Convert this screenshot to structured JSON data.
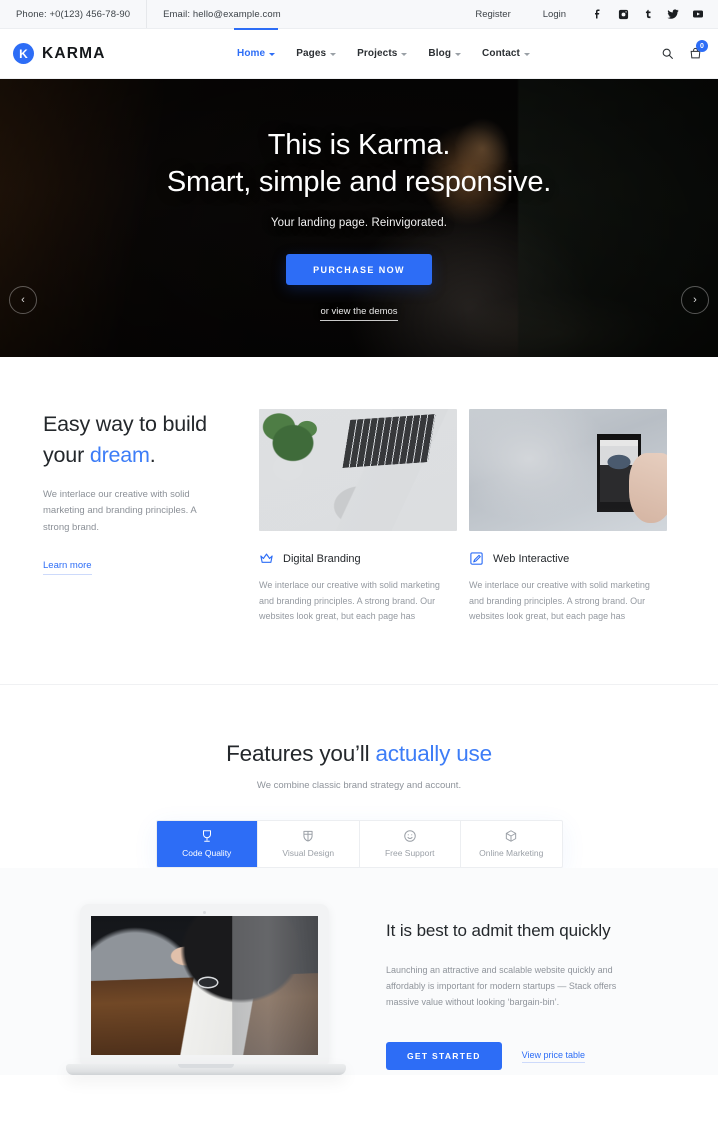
{
  "topbar": {
    "phone": "Phone: +0(123) 456-78-90",
    "email": "Email: hello@example.com",
    "register": "Register",
    "login": "Login",
    "socials": [
      {
        "name": "facebook-icon",
        "label": "f"
      },
      {
        "name": "instagram-icon",
        "label": ""
      },
      {
        "name": "tumblr-icon",
        "label": "t"
      },
      {
        "name": "twitter-icon",
        "label": ""
      },
      {
        "name": "youtube-icon",
        "label": ""
      }
    ]
  },
  "nav": {
    "brand": "KARMA",
    "logo_letter": "K",
    "accent_color": "#2d6df6",
    "items": [
      {
        "label": "Home",
        "active": true,
        "caret": true
      },
      {
        "label": "Pages",
        "active": false,
        "caret": true
      },
      {
        "label": "Projects",
        "active": false,
        "caret": true
      },
      {
        "label": "Blog",
        "active": false,
        "caret": true
      },
      {
        "label": "Contact",
        "active": false,
        "caret": true
      }
    ],
    "cart_count": "0"
  },
  "hero": {
    "title_line1": "This is Karma.",
    "title_line2": "Smart, simple and responsive.",
    "subtitle": "Your landing page. Reinvigorated.",
    "cta": "PURCHASE NOW",
    "demos_link": "or view the demos",
    "prev": "‹",
    "next": "›"
  },
  "easy": {
    "heading_part1": "Easy way to build",
    "heading_part2": "your ",
    "heading_accent": "dream",
    "heading_end": ".",
    "body": "We interlace our creative with solid marketing and branding principles. A strong brand.",
    "link": "Learn more",
    "cards": [
      {
        "icon": "crown-icon",
        "title": "Digital Branding",
        "body": "We interlace our creative with solid marketing and branding principles. A strong brand. Our websites look great, but each page has"
      },
      {
        "icon": "edit-square-icon",
        "title": "Web Interactive",
        "body": "We interlace our creative with solid marketing and branding principles. A strong brand. Our websites look great, but each page has"
      }
    ]
  },
  "features": {
    "heading_part1": "Features you’ll ",
    "heading_accent": "actually use",
    "subtitle": "We combine classic brand strategy and account.",
    "tabs": [
      {
        "label": "Code Quality",
        "icon": "trophy-icon",
        "active": true
      },
      {
        "label": "Visual Design",
        "icon": "shield-icon",
        "active": false
      },
      {
        "label": "Free Support",
        "icon": "smiley-icon",
        "active": false
      },
      {
        "label": "Online Marketing",
        "icon": "box-icon",
        "active": false
      }
    ]
  },
  "admit": {
    "heading": "It is best to admit them quickly",
    "body": "Launching an attractive and scalable website quickly and affordably is important for modern startups — Stack offers massive value without looking ‘bargain-bin’.",
    "cta": "GET STARTED",
    "link": "View price table"
  }
}
